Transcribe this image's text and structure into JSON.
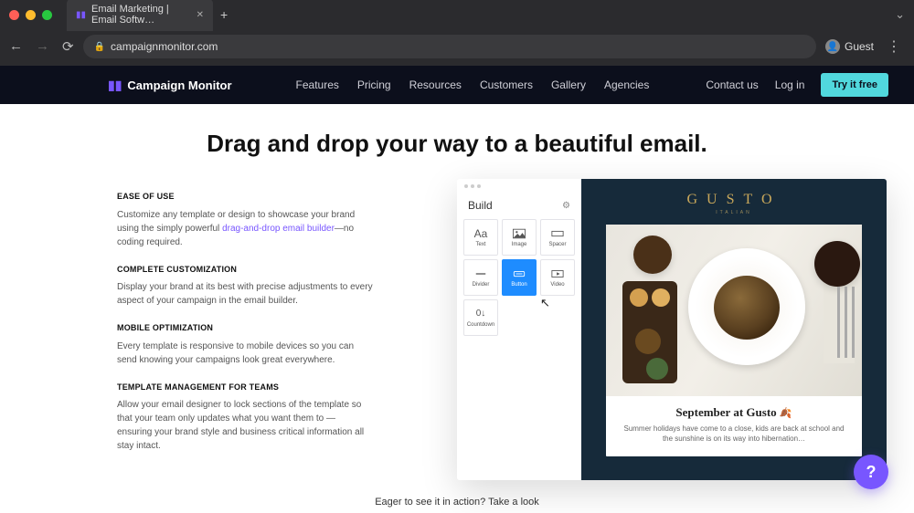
{
  "browser": {
    "tab_title": "Email Marketing | Email Softw…",
    "url": "campaignmonitor.com",
    "guest_label": "Guest"
  },
  "header": {
    "brand": "Campaign Monitor",
    "nav": [
      "Features",
      "Pricing",
      "Resources",
      "Customers",
      "Gallery",
      "Agencies"
    ],
    "contact": "Contact us",
    "login": "Log in",
    "cta": "Try it free"
  },
  "hero": {
    "headline": "Drag and drop your way to a beautiful email."
  },
  "sections": [
    {
      "title": "EASE OF USE",
      "body_pre": "Customize any template or design to showcase your brand using the simply powerful ",
      "link": "drag-and-drop email builder",
      "body_post": "—no coding required."
    },
    {
      "title": "COMPLETE CUSTOMIZATION",
      "body": "Display your brand at its best with precise adjustments to every aspect of your campaign in the email builder."
    },
    {
      "title": "MOBILE OPTIMIZATION",
      "body": "Every template is responsive to mobile devices so you can send knowing your campaigns look great everywhere."
    },
    {
      "title": "TEMPLATE MANAGEMENT FOR TEAMS",
      "body": "Allow your email designer to lock sections of the template so that your team only updates what you want them to — ensuring your brand style and business critical information all stay intact."
    }
  ],
  "builder": {
    "panel_title": "Build",
    "tools": [
      "Text",
      "Image",
      "Spacer",
      "Divider",
      "Button",
      "Video",
      "Countdown"
    ],
    "active_tool": "Button"
  },
  "preview": {
    "brand": "GUSTO",
    "brand_sub": "ITALIAN",
    "article_headline": "September at Gusto",
    "article_body": "Summer holidays have come to a close, kids are back at school and the sunshine is on its way into hibernation…"
  },
  "cta_footer": "Eager to see it in action? Take a look",
  "help": "?"
}
